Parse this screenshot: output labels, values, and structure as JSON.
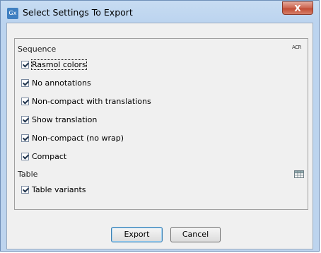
{
  "window": {
    "title": "Select Settings To Export",
    "app_icon_text": "Gx",
    "close_symbol": "X"
  },
  "sections": [
    {
      "label": "Sequence",
      "icon": "abc-sequence-icon",
      "icon_text": "ACR",
      "items": [
        {
          "label": "Rasmol colors",
          "checked": true
        },
        {
          "label": "No annotations",
          "checked": true
        },
        {
          "label": "Non-compact with translations",
          "checked": true
        },
        {
          "label": "Show translation",
          "checked": true
        },
        {
          "label": "Non-compact (no wrap)",
          "checked": true
        },
        {
          "label": "Compact",
          "checked": true
        }
      ]
    },
    {
      "label": "Table",
      "icon": "table-icon",
      "items": [
        {
          "label": "Table variants",
          "checked": true
        }
      ]
    }
  ],
  "buttons": {
    "export": "Export",
    "cancel": "Cancel"
  }
}
